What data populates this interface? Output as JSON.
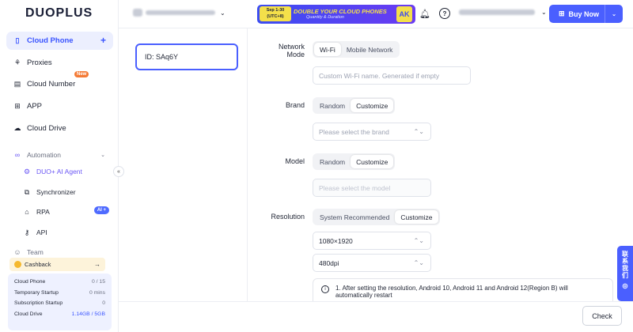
{
  "brand": {
    "logo_text": "DUOPLUS"
  },
  "sidebar": {
    "items": [
      {
        "label": "Cloud Phone",
        "icon": "phone-icon"
      },
      {
        "label": "Proxies",
        "icon": "proxy-icon"
      },
      {
        "label": "Cloud Number",
        "icon": "number-icon",
        "badge": "New"
      },
      {
        "label": "APP",
        "icon": "grid-icon"
      },
      {
        "label": "Cloud Drive",
        "icon": "cloud-icon"
      }
    ],
    "automation": {
      "label": "Automation",
      "items": [
        {
          "label": "DUO+ AI Agent"
        },
        {
          "label": "Synchronizer"
        },
        {
          "label": "RPA",
          "badge": "AI +"
        },
        {
          "label": "API"
        }
      ]
    },
    "team_label": "Team",
    "cashback": "Cashback",
    "usage": [
      {
        "label": "Cloud Phone",
        "value": "0 / 15"
      },
      {
        "label": "Temporary Startup",
        "value": "0 mins"
      },
      {
        "label": "Subscription Startup",
        "value": "0"
      },
      {
        "label": "Cloud Drive",
        "value": "1.14GB / 5GB"
      }
    ]
  },
  "header": {
    "banner": {
      "date": "Sep 1-30",
      "date_sub": "(UTC+8)",
      "title": "DOUBLE YOUR CLOUD PHONES",
      "sub": "Quantity & Duration",
      "badge": "AK"
    },
    "buy_label": "Buy Now"
  },
  "device": {
    "id_label": "ID: SAq6Y"
  },
  "form": {
    "network_mode": {
      "label_line1": "Network",
      "label_line2": "Mode",
      "options": [
        "Wi-Fi",
        "Mobile Network"
      ],
      "selected": 0,
      "placeholder": "Custom Wi-Fi name. Generated if empty"
    },
    "brand": {
      "label": "Brand",
      "options": [
        "Random",
        "Customize"
      ],
      "selected": 1,
      "placeholder": "Please select the brand"
    },
    "model": {
      "label": "Model",
      "options": [
        "Random",
        "Customize"
      ],
      "selected": 1,
      "placeholder": "Please select the model"
    },
    "resolution": {
      "label": "Resolution",
      "options": [
        "System Recommended",
        "Customize"
      ],
      "selected": 1,
      "size": "1080×1920",
      "dpi": "480dpi"
    },
    "note": "1. After setting the resolution, Android 10, Android 11 and Android 12(Region B) will automatically restart"
  },
  "footer": {
    "check_label": "Check"
  },
  "contact": {
    "chars": [
      "联",
      "系",
      "我",
      "们"
    ]
  }
}
